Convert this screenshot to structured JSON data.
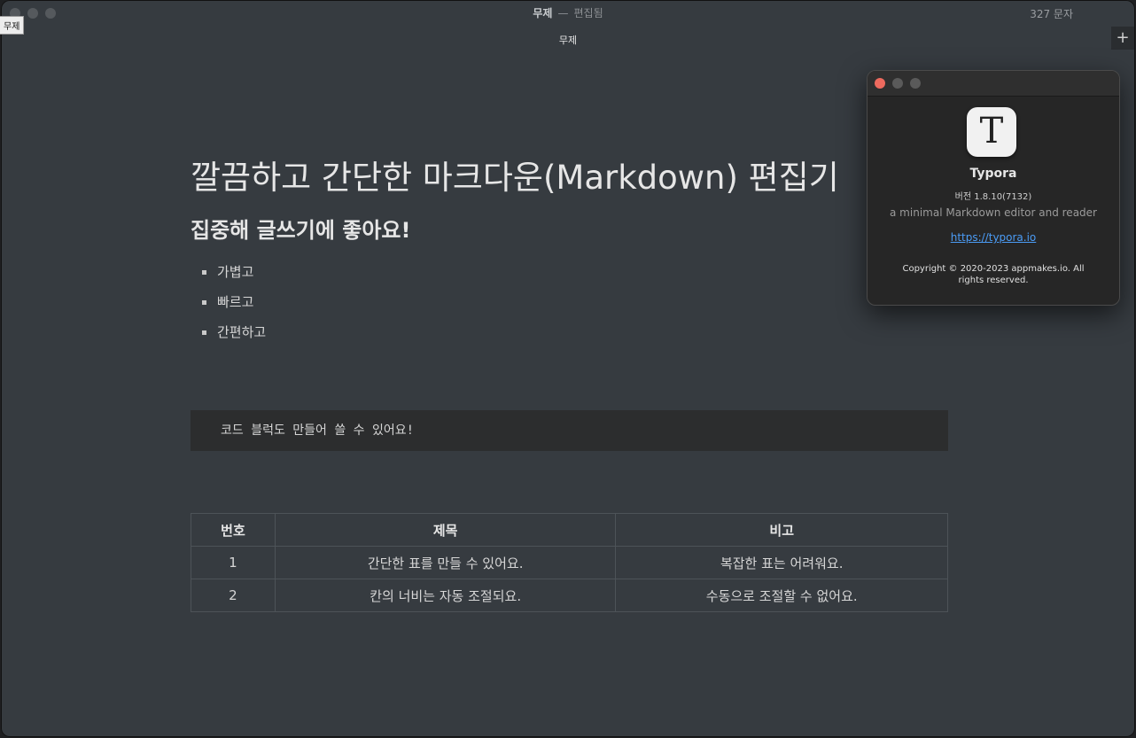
{
  "window": {
    "title": "무제",
    "separator": "—",
    "state": "편집됨",
    "word_count": "327 문자",
    "tooltip": "무제",
    "tab_title": "무제",
    "plus_label": "+"
  },
  "doc": {
    "h1": "깔끔하고 간단한 마크다운(Markdown) 편집기",
    "h2": "집중해 글쓰기에 좋아요!",
    "list": [
      "가볍고",
      "빠르고",
      "간편하고"
    ],
    "code": "코드 블럭도 만들어 쓸 수 있어요!",
    "table": {
      "headers": [
        "번호",
        "제목",
        "비고"
      ],
      "rows": [
        [
          "1",
          "간단한 표를 만들 수 있어요.",
          "복잡한 표는 어려워요."
        ],
        [
          "2",
          "칸의 너비는 자동 조절되요.",
          "수동으로 조절할 수 없어요."
        ]
      ]
    }
  },
  "about": {
    "icon_letter": "T",
    "name": "Typora",
    "version": "버전 1.8.10(7132)",
    "description": "a minimal Markdown editor and reader",
    "link": "https://typora.io",
    "copyright": "Copyright © 2020-2023 appmakes.io. All rights reserved."
  }
}
